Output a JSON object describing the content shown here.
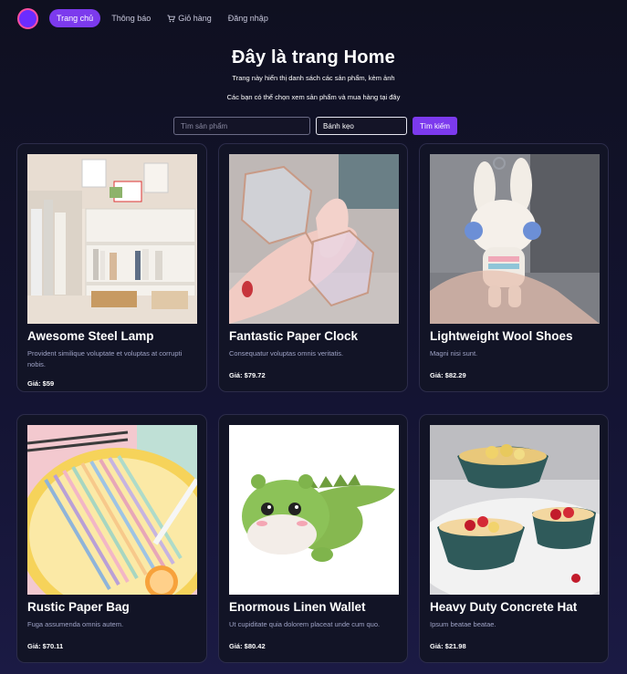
{
  "nav": {
    "items": [
      {
        "label": "Trang chủ",
        "active": true
      },
      {
        "label": "Thông báo",
        "active": false
      },
      {
        "label": "Giỏ hàng",
        "active": false,
        "icon": "cart-icon"
      },
      {
        "label": "Đăng nhập",
        "active": false
      }
    ]
  },
  "hero": {
    "title": "Đây là trang Home",
    "line1": "Trang này hiển thị danh sách các sản phẩm, kèm ảnh",
    "line2": "Các bạn có thể chọn xem sản phẩm và mua hàng tại đây"
  },
  "search": {
    "placeholder": "Tìm sản phẩm",
    "category_value": "Bánh kẹo",
    "button_label": "Tìm kiếm"
  },
  "products": [
    {
      "name": "Awesome Steel Lamp",
      "description": "Provident similique voluptate et voluptas at corrupti nobis.",
      "price": "Giá: $59",
      "image": "bookshelf-photo"
    },
    {
      "name": "Fantastic Paper Clock",
      "description": "Consequatur voluptas omnis veritatis.",
      "price": "Giá: $79.72",
      "image": "glasses-photo"
    },
    {
      "name": "Lightweight Wool Shoes",
      "description": "Magni nisi sunt.",
      "price": "Giá: $82.29",
      "image": "bunny-keychain-photo"
    },
    {
      "name": "Rustic Paper Bag",
      "description": "Fuga assumenda omnis autem.",
      "price": "Giá: $70.11",
      "image": "pencils-photo"
    },
    {
      "name": "Enormous Linen Wallet",
      "description": "Ut cupiditate quia dolorem placeat unde cum quo.",
      "price": "Giá: $80.42",
      "image": "dinosaur-plush-photo"
    },
    {
      "name": "Heavy Duty Concrete Hat",
      "description": "Ipsum beatae beatae.",
      "price": "Giá: $21.98",
      "image": "fruit-bowls-photo"
    }
  ],
  "colors": {
    "accent": "#7c3aed",
    "background": "#0f1020",
    "card_border": "#2c2c4a"
  }
}
